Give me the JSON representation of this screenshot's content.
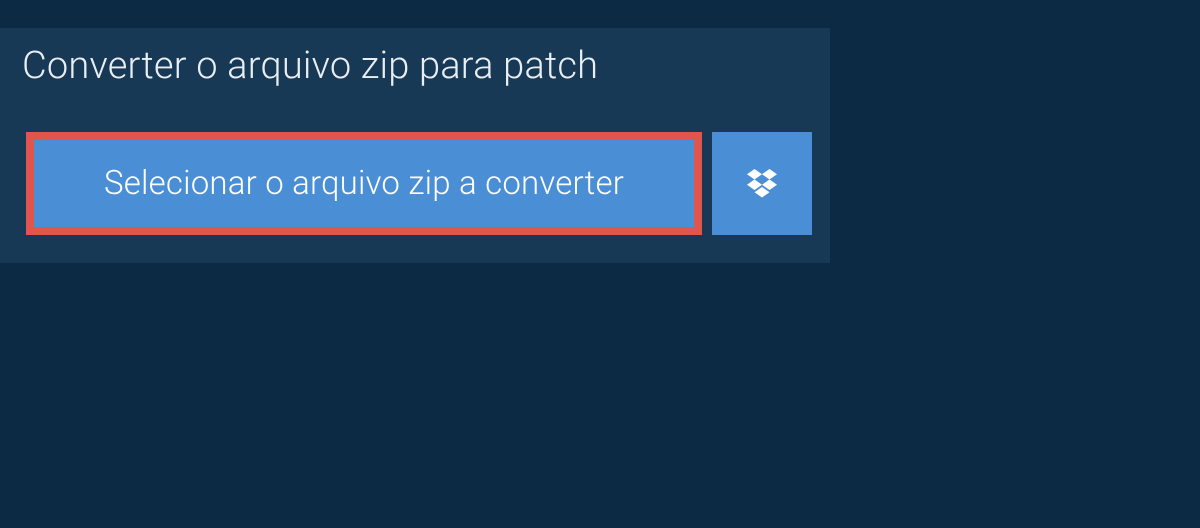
{
  "header": {
    "title": "Converter o arquivo zip para patch"
  },
  "actions": {
    "select_file_label": "Selecionar o arquivo zip a converter"
  },
  "colors": {
    "page_bg": "#0c2a44",
    "panel_bg": "#173955",
    "button_bg": "#4a8fd6",
    "highlight_border": "#e0564c",
    "text_light": "#e9eef3",
    "text_white": "#ffffff"
  }
}
